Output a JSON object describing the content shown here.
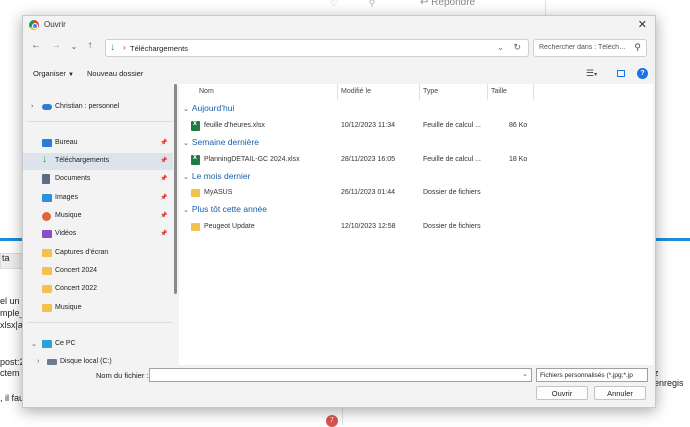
{
  "background": {
    "reply_label": "Répondre",
    "left_texts": [
      "ta",
      "el un",
      "mple_",
      "xlsx|att",
      "post:2",
      "ctem",
      ", il fau"
    ],
    "right_text": "z enregis",
    "badge": "7"
  },
  "dialog": {
    "title": "Ouvrir",
    "address": {
      "location": "Téléchargements"
    },
    "search": {
      "placeholder": "Rechercher dans : Téléchargements"
    },
    "toolbar": {
      "organize": "Organiser",
      "new_folder": "Nouveau dossier"
    },
    "sidebar": {
      "top": {
        "label": "Christian : personnel"
      },
      "items": [
        {
          "label": "Bureau",
          "pinned": true,
          "color": "#2b7cd3"
        },
        {
          "label": "Téléchargements",
          "pinned": true,
          "color": "#0f9d58",
          "selected": true
        },
        {
          "label": "Documents",
          "pinned": true,
          "color": "#5b6d85"
        },
        {
          "label": "Images",
          "pinned": true,
          "color": "#2f8fd8"
        },
        {
          "label": "Musique",
          "pinned": true,
          "color": "#e0653a"
        },
        {
          "label": "Vidéos",
          "pinned": true,
          "color": "#8a4fc7"
        },
        {
          "label": "Captures d’écran",
          "pinned": false,
          "color": "#f2c14e"
        },
        {
          "label": "Concert 2024",
          "pinned": false,
          "color": "#f2c14e"
        },
        {
          "label": "Concert 2022",
          "pinned": false,
          "color": "#f2c14e"
        },
        {
          "label": "Musique",
          "pinned": false,
          "color": "#f2c14e"
        }
      ],
      "this_pc": "Ce PC",
      "local_disk": "Disque local (C:)"
    },
    "columns": {
      "name": "Nom",
      "modified": "Modifié le",
      "type": "Type",
      "size": "Taille"
    },
    "groups": [
      {
        "label": "Aujourd’hui",
        "files": [
          {
            "name": "feuille d'heures.xlsx",
            "modified": "10/12/2023 11:34",
            "type": "Feuille de calcul ...",
            "size": "86 Ko",
            "icon": "xlsx"
          }
        ]
      },
      {
        "label": "Semaine dernière",
        "files": [
          {
            "name": "PlanningDETAIL-GC 2024.xlsx",
            "modified": "28/11/2023 16:05",
            "type": "Feuille de calcul ...",
            "size": "18 Ko",
            "icon": "xlsx"
          }
        ]
      },
      {
        "label": "Le mois dernier",
        "files": [
          {
            "name": "MyASUS",
            "modified": "26/11/2023 01:44",
            "type": "Dossier de fichiers",
            "size": "",
            "icon": "folder"
          }
        ]
      },
      {
        "label": "Plus tôt cette année",
        "files": [
          {
            "name": "Peugeot Update",
            "modified": "12/10/2023 12:58",
            "type": "Dossier de fichiers",
            "size": "",
            "icon": "folder"
          }
        ]
      }
    ],
    "footer": {
      "filename_label": "Nom du fichier :",
      "filename_value": "",
      "filter": "Fichiers personnalisés (*.jpg;*.jp",
      "open": "Ouvrir",
      "cancel": "Annuler"
    }
  }
}
